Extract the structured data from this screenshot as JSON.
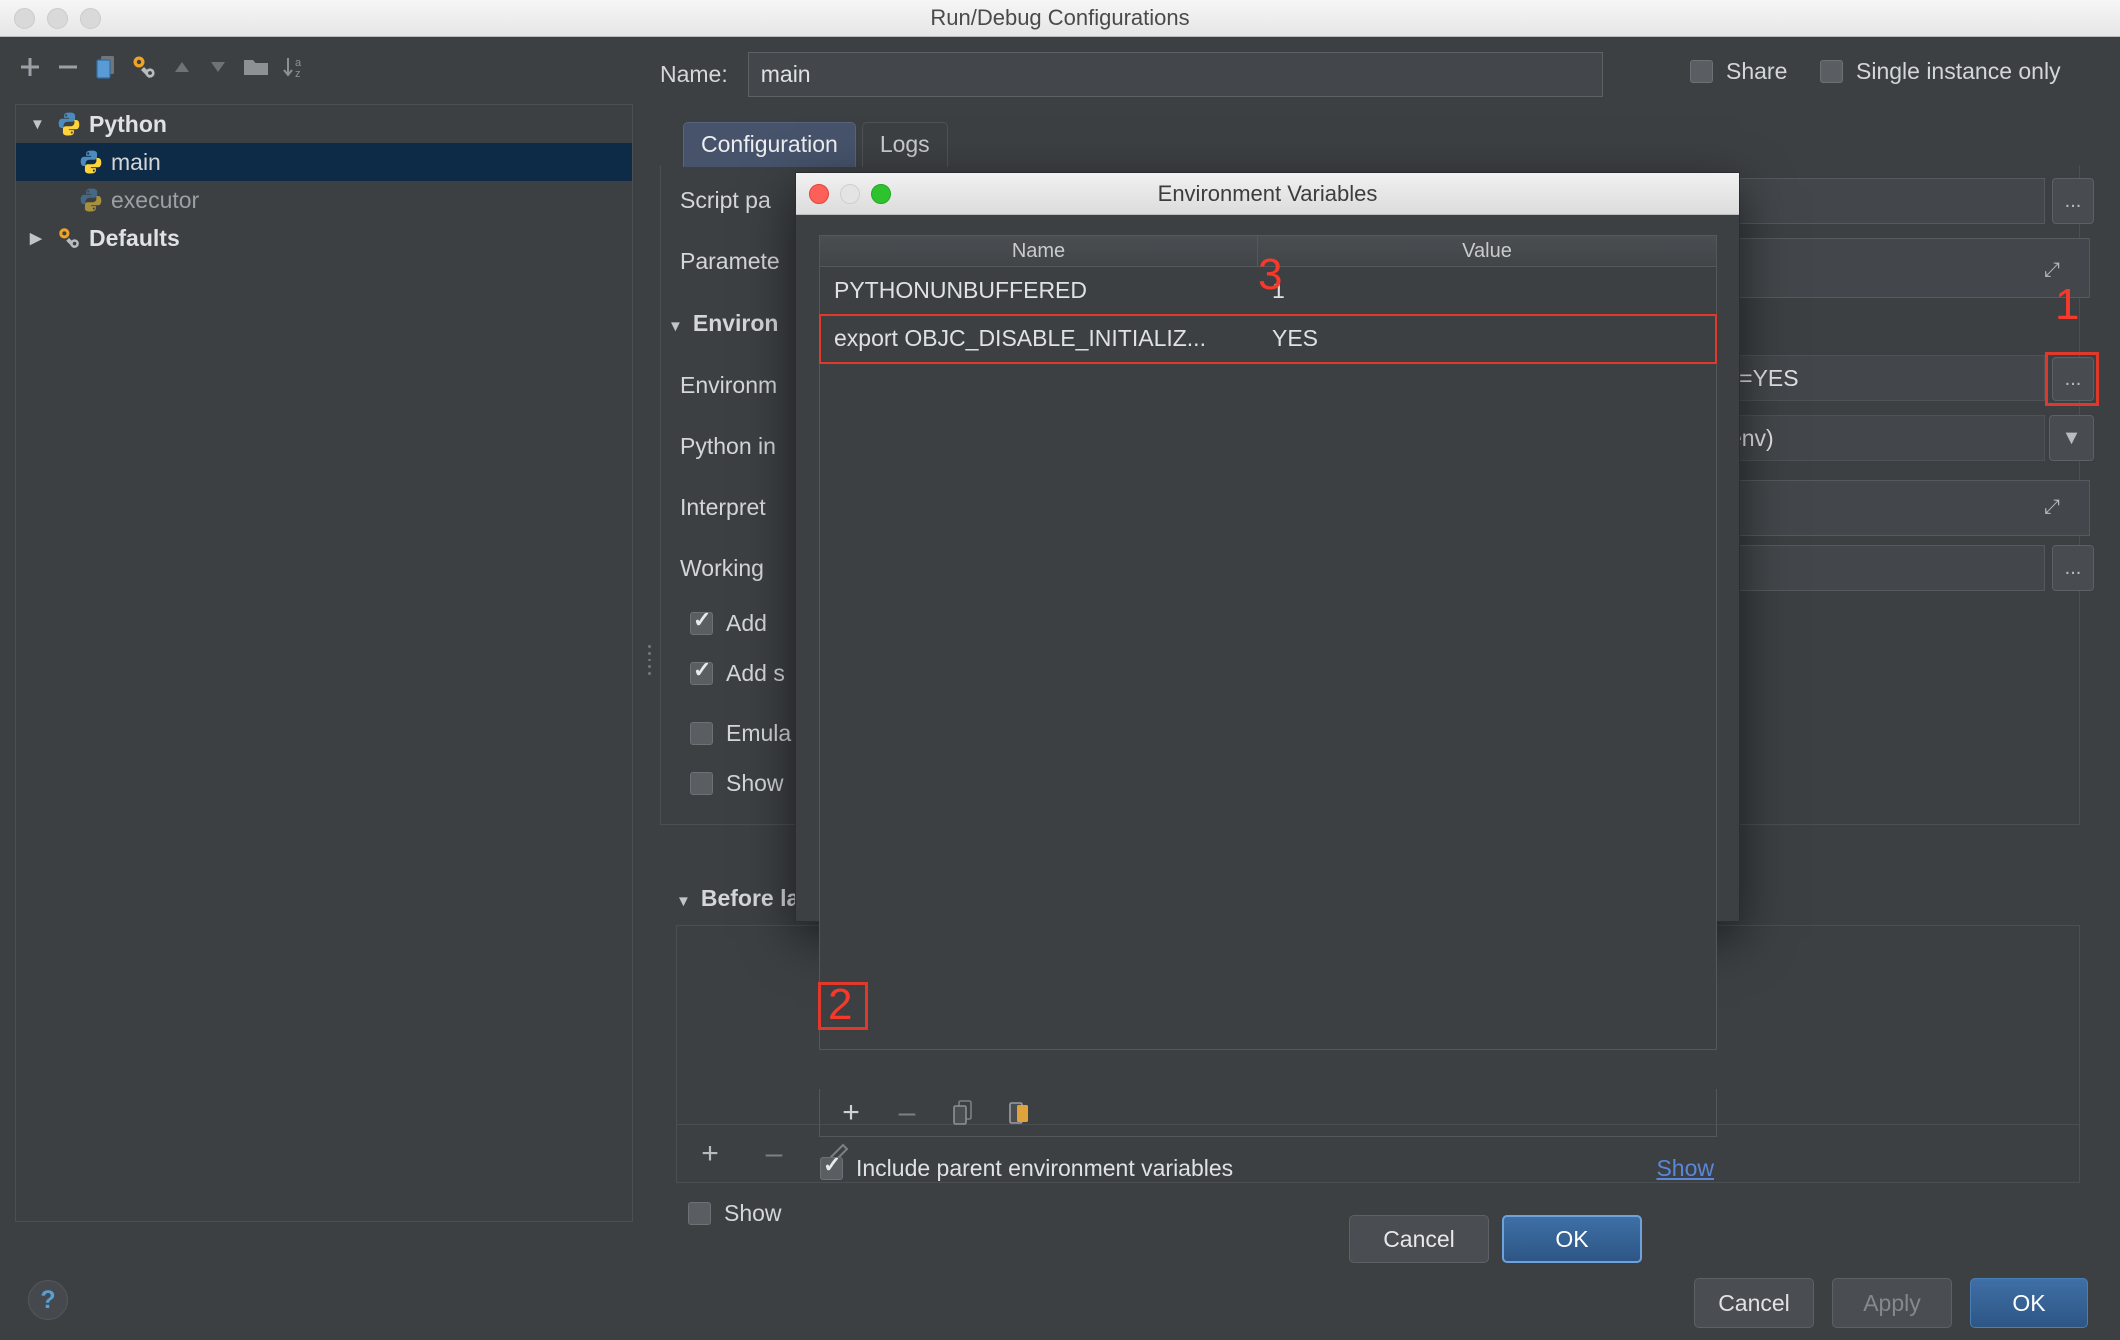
{
  "window": {
    "title": "Run/Debug Configurations",
    "traffic_lights": [
      "close-button",
      "minimize-button",
      "zoom-button"
    ]
  },
  "toolbar": {
    "buttons": [
      {
        "name": "add-configuration-button",
        "glyph": "+"
      },
      {
        "name": "remove-configuration-button",
        "glyph": "–"
      },
      {
        "name": "copy-configuration-button",
        "glyph": "copy-icon"
      },
      {
        "name": "edit-defaults-button",
        "glyph": "wrench-icon"
      },
      {
        "name": "move-up-button",
        "glyph": "▲"
      },
      {
        "name": "move-down-button",
        "glyph": "▼"
      },
      {
        "name": "new-folder-button",
        "glyph": "folder-icon"
      },
      {
        "name": "sort-alphabetically-button",
        "glyph": "sort-az-icon"
      }
    ]
  },
  "tree": {
    "items": [
      {
        "label": "Python",
        "level": 0,
        "expanded": true,
        "icon": "python-icon",
        "selected": false,
        "dim": false,
        "bold": true
      },
      {
        "label": "main",
        "level": 1,
        "expanded": null,
        "icon": "python-icon",
        "selected": true,
        "dim": false,
        "bold": false
      },
      {
        "label": "executor",
        "level": 1,
        "expanded": null,
        "icon": "python-icon",
        "selected": false,
        "dim": true,
        "bold": false
      },
      {
        "label": "Defaults",
        "level": 0,
        "expanded": false,
        "icon": "wrench-icon",
        "selected": false,
        "dim": false,
        "bold": true
      }
    ]
  },
  "header": {
    "name_label": "Name:",
    "name_value": "main",
    "name_placeholder": "",
    "share_label": "Share",
    "share_checked": false,
    "single_instance_label": "Single instance only",
    "single_instance_checked": false
  },
  "tabs": [
    {
      "label": "Configuration",
      "active": true
    },
    {
      "label": "Logs",
      "active": false
    }
  ],
  "config_fields": {
    "script_path_label": "Script pa",
    "parameters_label": "Paramete",
    "environment_section_label": "Environ",
    "environment_vars_label": "Environm",
    "python_interpreter_label": "Python in",
    "interpreter_options_label": "Interpret",
    "working_dir_label": "Working",
    "add_content_roots_label": "Add ",
    "add_source_roots_label": "Add s",
    "emulate_terminal_label": "Emula",
    "show_command_line_label": "Show",
    "env_value_visible": "FORK_SAFETY=YES",
    "interpreter_value_visible": "ub/IDEServer/venv)",
    "browse_glyph": "...",
    "expand_glyph": "⤢",
    "dropdown_glyph": "▼"
  },
  "before_launch": {
    "section_label": "Before lau",
    "toolbar_buttons": [
      {
        "name": "add-task-button",
        "glyph": "+"
      },
      {
        "name": "remove-task-button",
        "glyph": "–"
      },
      {
        "name": "edit-task-button",
        "glyph": "pencil-icon"
      }
    ],
    "show_page_label": "Show",
    "show_page_checked": false
  },
  "bottom_bar": {
    "help_glyph": "?",
    "cancel_label": "Cancel",
    "apply_label": "Apply",
    "apply_disabled": true,
    "ok_label": "OK"
  },
  "env_dialog": {
    "title": "Environment Variables",
    "columns": [
      "Name",
      "Value"
    ],
    "rows": [
      {
        "name": "PYTHONUNBUFFERED",
        "value": "1",
        "highlighted": false
      },
      {
        "name": "export OBJC_DISABLE_INITIALIZ...",
        "value": "YES",
        "highlighted": true
      }
    ],
    "row_toolbar": [
      {
        "name": "add-variable-button",
        "glyph": "+",
        "enabled": true
      },
      {
        "name": "remove-variable-button",
        "glyph": "–",
        "enabled": false
      },
      {
        "name": "copy-variable-button",
        "glyph": "copy-icon",
        "enabled": false
      },
      {
        "name": "paste-variable-button",
        "glyph": "paste-icon",
        "enabled": true
      }
    ],
    "include_parent_label": "Include parent environment variables",
    "include_parent_checked": true,
    "show_link_label": "Show",
    "cancel_label": "Cancel",
    "ok_label": "OK"
  },
  "annotations": [
    {
      "id": "anno-1",
      "text": "1"
    },
    {
      "id": "anno-2",
      "text": "2"
    },
    {
      "id": "anno-3",
      "text": "3"
    }
  ],
  "colors": {
    "background": "#3c4043",
    "selection": "#0d2a46",
    "accent_blue": "#3f6fa6",
    "link": "#5b87d8",
    "annotation_red": "#f5392b"
  }
}
